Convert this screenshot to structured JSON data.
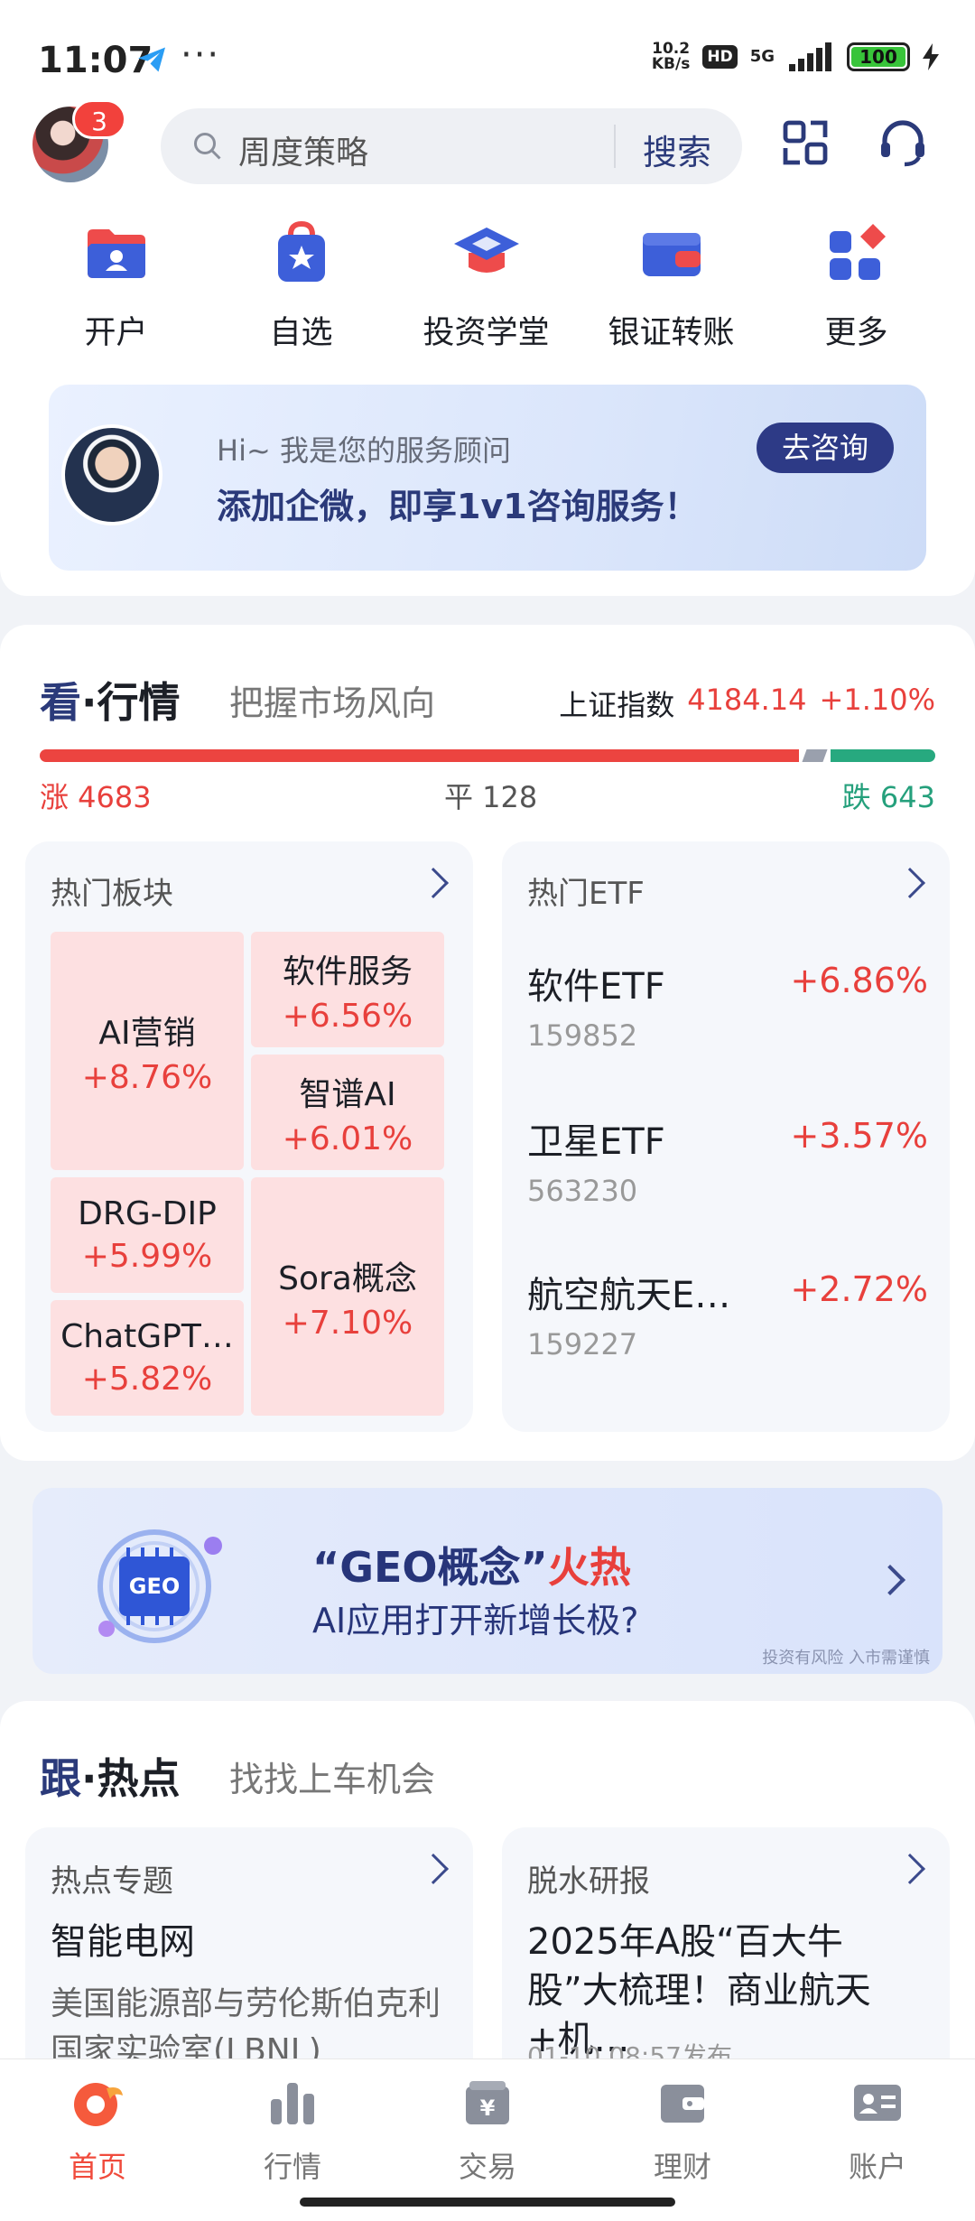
{
  "status": {
    "time": "11:07",
    "dots": "···",
    "speed_top": "10.2",
    "speed_bottom": "KB/s",
    "hd": "HD",
    "network": "5G",
    "battery": "100"
  },
  "header": {
    "badge": "3",
    "search_placeholder": "周度策略",
    "search_button": "搜索"
  },
  "quick_actions": [
    {
      "label": "开户",
      "icon": "folder-user-icon"
    },
    {
      "label": "自选",
      "icon": "bag-star-icon"
    },
    {
      "label": "投资学堂",
      "icon": "graduation-cap-icon"
    },
    {
      "label": "银证转账",
      "icon": "wallet-icon"
    },
    {
      "label": "更多",
      "icon": "grid-more-icon"
    }
  ],
  "advisor": {
    "greeting": "Hi~ 我是您的服务顾问",
    "headline": "添加企微，即享1v1咨询服务！",
    "button": "去咨询"
  },
  "market": {
    "title_a": "看",
    "title_dot": "·",
    "title_b": "行情",
    "subtitle": "把握市场风向",
    "index_name": "上证指数",
    "index_value": "4184.14",
    "index_change": "+1.10%",
    "up_label": "涨 4683",
    "flat_label": "平 128",
    "down_label": "跌 643",
    "up_count": 4683,
    "flat_count": 128,
    "down_count": 643,
    "sectors_title": "热门板块",
    "sectors": [
      {
        "name": "AI营销",
        "pct": "+8.76%"
      },
      {
        "name": "软件服务",
        "pct": "+6.56%"
      },
      {
        "name": "智谱AI",
        "pct": "+6.01%"
      },
      {
        "name": "DRG-DIP",
        "pct": "+5.99%"
      },
      {
        "name": "Sora概念",
        "pct": "+7.10%"
      },
      {
        "name": "ChatGPT…",
        "pct": "+5.82%"
      }
    ],
    "etf_title": "热门ETF",
    "etfs": [
      {
        "name": "软件ETF",
        "code": "159852",
        "pct": "+6.86%"
      },
      {
        "name": "卫星ETF",
        "code": "563230",
        "pct": "+3.57%"
      },
      {
        "name": "航空航天E…",
        "code": "159227",
        "pct": "+2.72%"
      }
    ]
  },
  "banner": {
    "chip_text": "GEO",
    "title_a": "“GEO概念”",
    "title_b": "火热",
    "subtitle": "AI应用打开新增长极?",
    "risk": "投资有风险 入市需谨慎"
  },
  "hotspot": {
    "title_a": "跟",
    "title_dot": "·",
    "title_b": "热点",
    "subtitle": "找找上车机会",
    "topic_title": "热点专题",
    "topic_name": "智能电网",
    "topic_desc": "美国能源部与劳伦斯伯克利国家实验室(LBNL)",
    "report_title": "脱水研报",
    "report_headline": "2025年A股“百大牛股”大梳理！商业航天+机…",
    "report_date": "01-10 08:57发布"
  },
  "tabs": [
    {
      "label": "首页",
      "icon": "home-icon"
    },
    {
      "label": "行情",
      "icon": "chart-bars-icon"
    },
    {
      "label": "交易",
      "icon": "trade-yen-icon"
    },
    {
      "label": "理财",
      "icon": "wallet-icon"
    },
    {
      "label": "账户",
      "icon": "account-card-icon"
    }
  ],
  "colors": {
    "rise": "#e8403c",
    "fall": "#25a07c",
    "brand": "#2d3a86",
    "active_tab": "#f04b3c"
  }
}
